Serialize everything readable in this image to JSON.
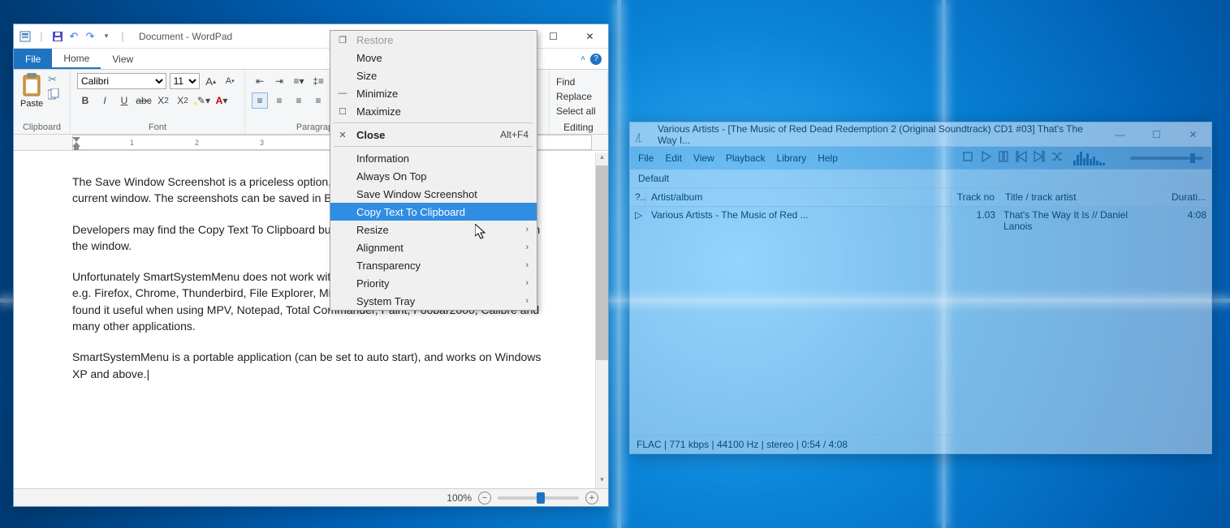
{
  "wordpad": {
    "title": "Document - WordPad",
    "tabs": {
      "file": "File",
      "home": "Home",
      "view": "View"
    },
    "ribbon": {
      "clipboard_label": "Clipboard",
      "paste": "Paste",
      "font_label": "Font",
      "font_name": "Calibri",
      "font_size": "11",
      "paragraph_label": "Paragraph",
      "editing_label": "Editing",
      "find": "Find",
      "replace": "Replace",
      "select_all": "Select all"
    },
    "document": {
      "p1": "The Save Window Screenshot is a priceless option, as it allows you save an image of the current window. The screenshots can be saved in BMP, JPEG, PNG or GIF formats.",
      "p2": "Developers may find the Copy Text To Clipboard button useful, as it copies all of the text from the window.",
      "p3": "Unfortunately SmartSystemMenu does not work with programs which have their own menu, e.g. Firefox, Chrome, Thunderbird, File Explorer, Microsoft Office applications, etc. But I still found it useful when using MPV, Notepad, Total Commander, Paint, Foobar2000, Calibre and many other applications.",
      "p4": "SmartSystemMenu is a portable application (can be set to auto start), and works on Windows XP and above."
    },
    "status": {
      "zoom": "100%"
    }
  },
  "sysmenu": {
    "restore": "Restore",
    "move": "Move",
    "size": "Size",
    "minimize": "Minimize",
    "maximize": "Maximize",
    "close": "Close",
    "close_accel": "Alt+F4",
    "information": "Information",
    "always_on_top": "Always On Top",
    "save_screenshot": "Save Window Screenshot",
    "copy_text": "Copy Text To Clipboard",
    "resize": "Resize",
    "alignment": "Alignment",
    "transparency": "Transparency",
    "priority": "Priority",
    "system_tray": "System Tray"
  },
  "foobar": {
    "title": "Various Artists - [The Music of Red Dead Redemption 2 (Original Soundtrack) CD1 #03] That's The Way I...",
    "menu": {
      "file": "File",
      "edit": "Edit",
      "view": "View",
      "playback": "Playback",
      "library": "Library",
      "help": "Help"
    },
    "tab": "Default",
    "columns": {
      "c1": "?..",
      "c2": "Artist/album",
      "c3": "Track no",
      "c4": "Title / track artist",
      "c5": "Durati..."
    },
    "row": {
      "artist": "Various Artists - The Music of Red ...",
      "trackno": "1.03",
      "title": "That's The Way It Is // Daniel Lanois",
      "duration": "4:08"
    },
    "status": "FLAC | 771 kbps | 44100 Hz | stereo | 0:54 / 4:08"
  }
}
